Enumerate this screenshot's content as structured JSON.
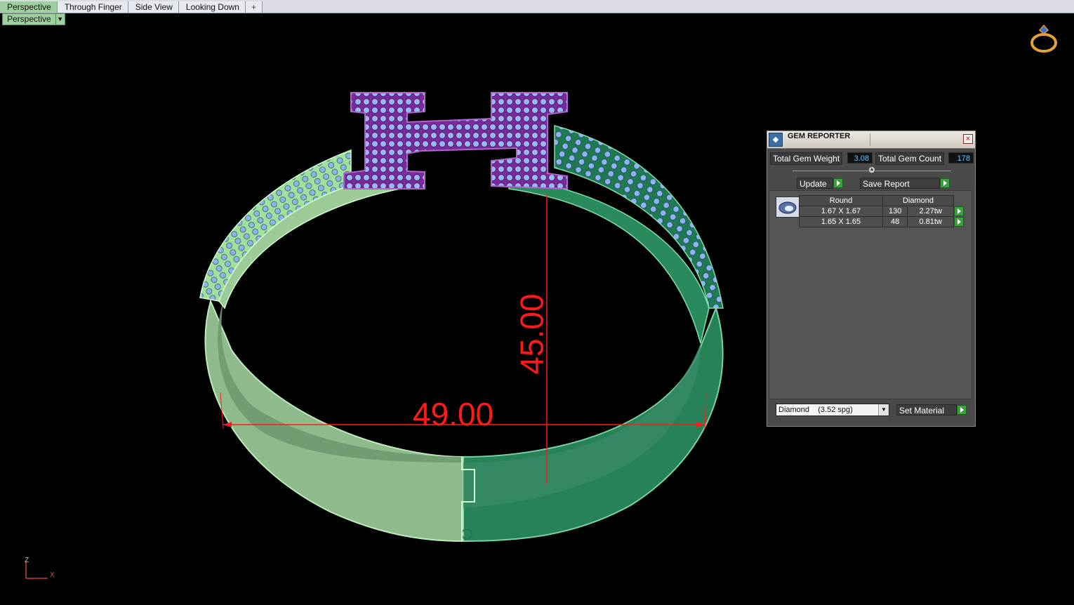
{
  "tabs": [
    {
      "label": "Perspective",
      "active": true
    },
    {
      "label": "Through Finger",
      "active": false
    },
    {
      "label": "Side View",
      "active": false
    },
    {
      "label": "Looking Down",
      "active": false
    }
  ],
  "add_tab_glyph": "+",
  "viewport": {
    "label": "Perspective",
    "dimension_width": "49.00",
    "dimension_height": "45.00",
    "axis_z": "Z",
    "axis_x": "X",
    "colors": {
      "dimension": "#ff1a1a",
      "band_light": "#9fe0a0",
      "band_dark": "#1f7a52",
      "gem": "#8fb3f0",
      "setting": "#7a2a9a"
    }
  },
  "gem_reporter": {
    "title": "GEM REPORTER",
    "close_glyph": "×",
    "total_gem_weight_label": "Total Gem Weight",
    "total_gem_weight": "3.08",
    "total_gem_count_label": "Total Gem Count",
    "total_gem_count": "178",
    "update_label": "Update",
    "save_report_label": "Save Report",
    "table": {
      "col_shape": "Round",
      "col_material": "Diamond",
      "rows": [
        {
          "size": "1.67 X 1.67",
          "count": "130",
          "weight": "2.27tw"
        },
        {
          "size": "1.65 X 1.65",
          "count": "48",
          "weight": "0.81tw"
        }
      ]
    },
    "material_select": "Diamond    (3.52 spg)",
    "set_material_label": "Set Material"
  }
}
